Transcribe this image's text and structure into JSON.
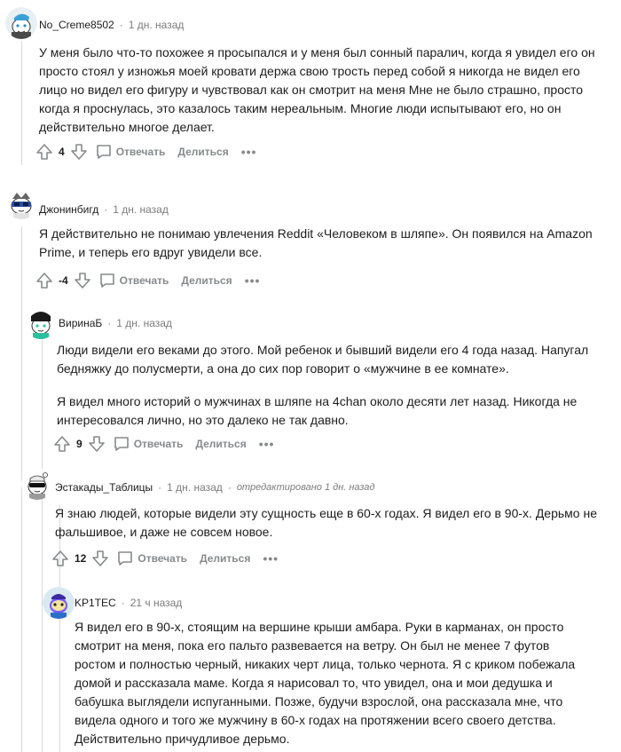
{
  "comments": [
    {
      "username": "No_Creme8502",
      "time": "1 дн. назад",
      "edited": "",
      "paragraphs": [
        "У меня было что-то похожее я просыпался и у меня был сонный паралич, когда я увидел его он просто стоял у изножья моей кровати держа свою трость перед собой я никогда не видел его лицо но видел его фигуру и чувствовал как он смотрит на меня Мне не было страшно, просто когда я проснулась, это казалось таким нереальным. Многие люди испытывают его, но он действительно многое делает."
      ],
      "score": "4",
      "reply_label": "Отвечать",
      "share_label": "Делиться",
      "more_label": "•••"
    },
    {
      "username": "Джонинбигд",
      "time": "1 дн. назад",
      "edited": "",
      "paragraphs": [
        "Я действительно не понимаю увлечения Reddit «Человеком в шляпе». Он появился на Amazon Prime, и теперь его вдруг увидели все."
      ],
      "score": "-4",
      "reply_label": "Отвечать",
      "share_label": "Делиться",
      "more_label": "•••"
    },
    {
      "username": "ВиринаБ",
      "time": "1 дн. назад",
      "edited": "",
      "paragraphs": [
        "Люди видели его веками до этого. Мой ребенок и бывший видели его 4 года назад. Напугал бедняжку до полусмерти, а она до сих пор говорит о «мужчине в ее комнате».",
        "Я видел много историй о мужчинах в шляпе на 4chan около десяти лет назад. Никогда не интересовался лично, но это далеко не так давно."
      ],
      "score": "9",
      "reply_label": "Отвечать",
      "share_label": "Делиться",
      "more_label": "•••"
    },
    {
      "username": "Эстакады_Таблицы",
      "time": "1 дн. назад",
      "edited": "отредактировано 1 дн. назад",
      "paragraphs": [
        "Я знаю людей, которые видели эту сущность еще в 60-х годах. Я видел его в 90-х. Дерьмо не фальшивое, и даже не совсем новое."
      ],
      "score": "12",
      "reply_label": "Отвечать",
      "share_label": "Делиться",
      "more_label": "•••"
    },
    {
      "username": "KP1TEC",
      "time": "21 ч назад",
      "edited": "",
      "paragraphs": [
        "Я видел его в 90-х, стоящим на вершине крыши амбара. Руки в карманах, он просто смотрит на меня, пока его пальто развевается на ветру. Он был не менее 7 футов ростом и полностью черный, никаких черт лица, только чернота. Я с криком побежала домой и рассказала маме. Когда я нарисовал то, что увидел, она и мои дедушка и бабушка выглядели испуганными. Позже, будучи взрослой, она рассказала мне, что видела одного и того же мужчину в 60-х годах на протяжении всего своего детства. Действительно причудливое дерьмо."
      ]
    }
  ],
  "colors": {
    "text": "#1c1c1c",
    "meta": "#7c7c7c",
    "action": "#878a8c",
    "thread_line": "#dadada"
  }
}
